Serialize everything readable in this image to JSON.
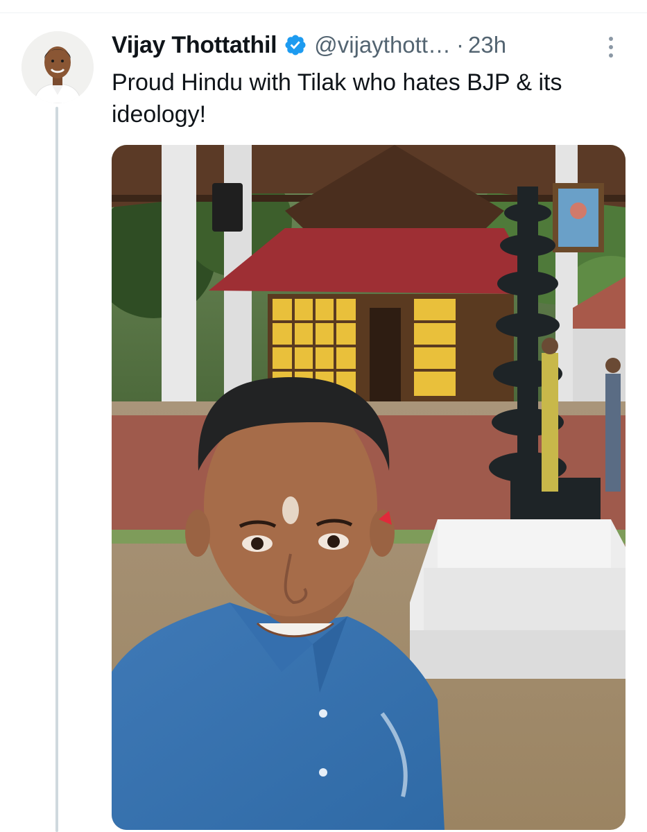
{
  "tweet": {
    "author_name": "Vijay Thottathil",
    "handle": "@vijaythott…",
    "separator": "·",
    "time": "23h",
    "text": "Proud Hindu with Tilak who hates BJP & its ideology!",
    "verified": true,
    "verified_color": "#1d9bf0"
  },
  "icons": {
    "verified": "verified-badge-icon",
    "more": "more-vertical-icon"
  },
  "colors": {
    "name_text": "#0f1419",
    "secondary_text": "#536471",
    "thread_line": "#cfd9de"
  }
}
